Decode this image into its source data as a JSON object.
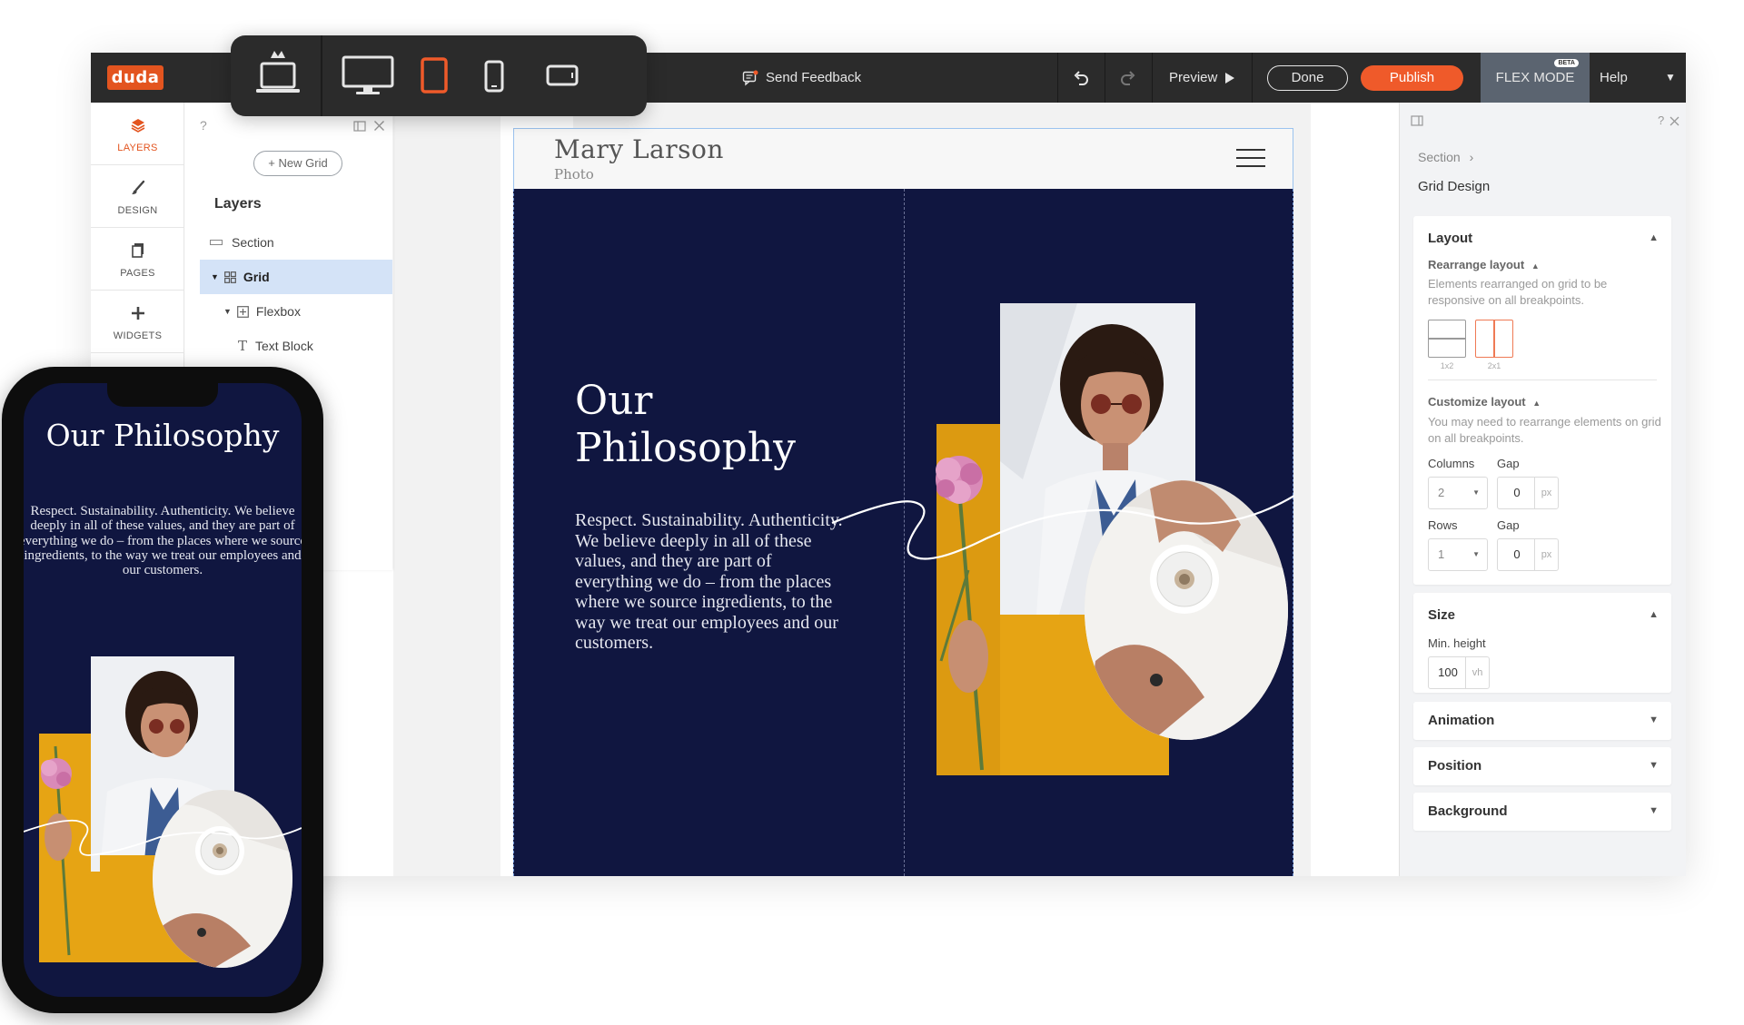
{
  "topbar": {
    "logo": "duda",
    "feedback": "Send Feedback",
    "preview": "Preview",
    "done": "Done",
    "publish": "Publish",
    "flex_mode": "FLEX MODE",
    "beta": "BETA",
    "help": "Help"
  },
  "devices": [
    "laptop-icon",
    "desktop-icon",
    "tablet-icon",
    "phone-icon",
    "phone-landscape-icon"
  ],
  "rail": {
    "items": [
      {
        "label": "LAYERS",
        "icon": "layers-icon"
      },
      {
        "label": "DESIGN",
        "icon": "brush-icon"
      },
      {
        "label": "PAGES",
        "icon": "pages-icon"
      },
      {
        "label": "WIDGETS",
        "icon": "plus-icon"
      }
    ]
  },
  "layers_panel": {
    "help": "?",
    "new_grid": "New Grid",
    "title": "Layers",
    "rows": [
      {
        "label": "Section"
      },
      {
        "label": "Grid"
      },
      {
        "label": "Flexbox"
      },
      {
        "label": "Text Block"
      }
    ]
  },
  "site": {
    "name": "Mary Larson",
    "subtitle": "Photo",
    "hero_title": "Our Philosophy",
    "hero_body": "Respect. Sustainability. Authenticity. We believe deeply in all of these values, and they are part of everything we do – from the places where we source ingredients, to the way we treat our employees and our customers."
  },
  "right_panel": {
    "breadcrumb": "Section",
    "title": "Grid Design",
    "layout": {
      "title": "Layout",
      "rearrange_title": "Rearrange layout",
      "rearrange_hint": "Elements rearranged on grid to be responsive on all breakpoints.",
      "options": [
        "1x2",
        "2x1"
      ],
      "customize_title": "Customize layout",
      "customize_hint": "You may need to rearrange elements on grid on all breakpoints.",
      "columns_label": "Columns",
      "columns_value": "2",
      "gap_label": "Gap",
      "gap_value": "0",
      "rows_label": "Rows",
      "rows_value": "1",
      "row_gap_label": "Gap",
      "row_gap_value": "0",
      "px": "px"
    },
    "size": {
      "title": "Size",
      "min_height_label": "Min. height",
      "min_height_value": "100",
      "unit": "vh"
    },
    "sections": [
      "Animation",
      "Position",
      "Background"
    ]
  },
  "phone": {
    "title": "Our Philosophy",
    "body": "Respect. Sustainability. Authenticity. We believe deeply in all of these values, and they are part of everything we do – from the places where we source ingredients, to the way we treat our employees and our customers."
  },
  "colors": {
    "brand": "#e3541f",
    "publish": "#ef5a2a",
    "hero_bg": "#101640",
    "selected_layer": "#d4e3f7",
    "topbar": "#2b2b2b"
  }
}
